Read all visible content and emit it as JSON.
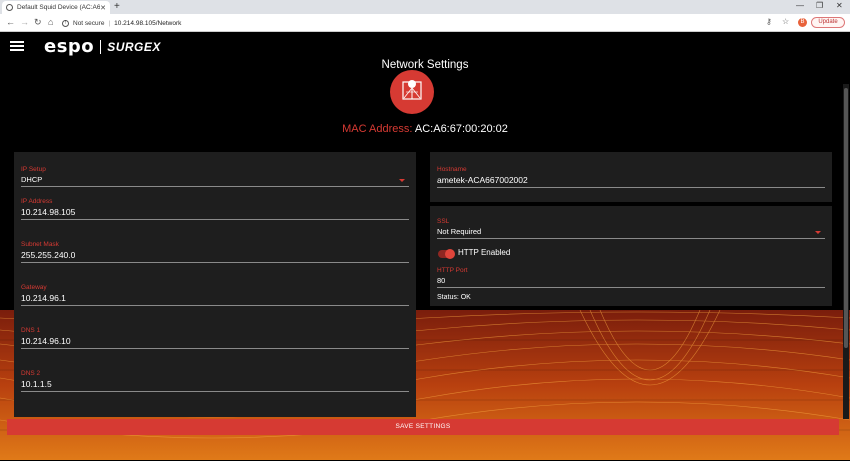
{
  "browser": {
    "tab_title": "Default Squid Device (AC:A6:67",
    "security": "Not secure",
    "url": "10.214.98.105/Network",
    "update_label": "Update",
    "avatar_letter": "B"
  },
  "app": {
    "logo_espo": "espo",
    "logo_surgex": "SURGEX",
    "page_title": "Network Settings",
    "mac_label": "MAC Address:",
    "mac_value": "AC:A6:67:00:20:02"
  },
  "left_card": {
    "ip_setup": {
      "label": "IP Setup",
      "value": "DHCP"
    },
    "ip_address": {
      "label": "IP Address",
      "value": "10.214.98.105"
    },
    "subnet_mask": {
      "label": "Subnet Mask",
      "value": "255.255.240.0"
    },
    "gateway": {
      "label": "Gateway",
      "value": "10.214.96.1"
    },
    "dns1": {
      "label": "DNS 1",
      "value": "10.214.96.10"
    },
    "dns2": {
      "label": "DNS 2",
      "value": "10.1.1.5"
    }
  },
  "hostname_card": {
    "hostname": {
      "label": "Hostname",
      "value": "ametek-ACA667002002"
    }
  },
  "ssl_card": {
    "ssl": {
      "label": "SSL",
      "value": "Not Required"
    },
    "http_toggle_label": "HTTP Enabled",
    "http_enabled": true,
    "http_port": {
      "label": "HTTP Port",
      "value": "80"
    },
    "status": "Status: OK"
  },
  "save_label": "SAVE SETTINGS",
  "colors": {
    "accent": "#d63a33",
    "card": "#1e1e1e",
    "background": "#000000"
  }
}
